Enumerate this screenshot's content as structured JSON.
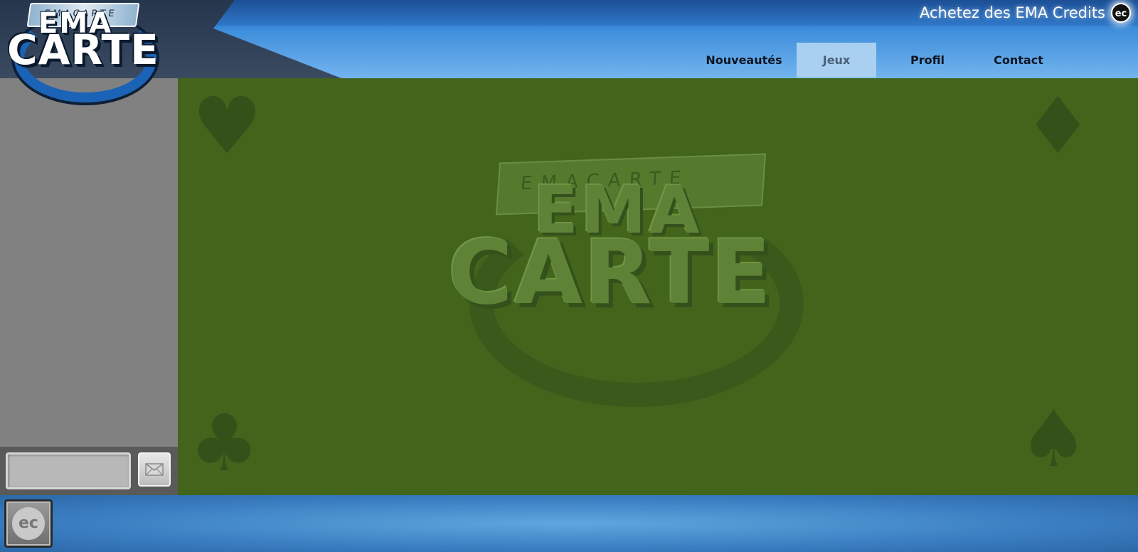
{
  "header": {
    "logo": {
      "top_text": "EMACARTE",
      "line1": "EMA",
      "line2": "CARTE"
    },
    "buy_credits_label": "Achetez des EMA Credits",
    "buy_credits_icon": {
      "icon": "ema-credits-icon",
      "text": "ec"
    }
  },
  "nav": {
    "items": [
      {
        "label": "Nouveautés",
        "active": false
      },
      {
        "label": "Jeux",
        "active": true
      },
      {
        "label": "Profil",
        "active": false
      },
      {
        "label": "Contact",
        "active": false
      }
    ]
  },
  "sidebar": {
    "chat_input_value": "",
    "send_icon": "envelope-icon"
  },
  "table": {
    "watermark": {
      "top_text": "EMACARTE",
      "line1": "EMA",
      "line2": "CARTE"
    },
    "suits": [
      "heart",
      "diamond",
      "club",
      "spade"
    ]
  },
  "footer": {
    "ec_button_text": "ec"
  },
  "colors": {
    "table_green": "#42641b",
    "sidebar_gray": "#818181",
    "header_blue": "#3f8fdc",
    "active_tab": "#a9d0f0"
  }
}
